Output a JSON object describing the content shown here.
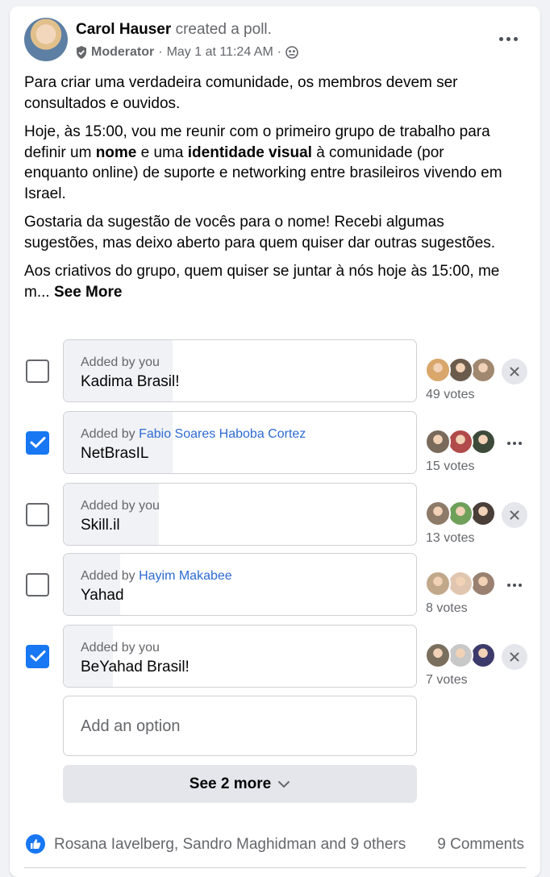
{
  "post": {
    "author": "Carol Hauser",
    "action": "created a poll.",
    "role": "Moderator",
    "timestamp": "May 1 at 11:24 AM",
    "separator": "·",
    "paragraph1": "Para criar uma verdadeira comunidade, os membros devem ser consultados e ouvidos.",
    "paragraph2_a": "Hoje, às 15:00, vou me reunir com o primeiro grupo de trabalho para definir um ",
    "paragraph2_b": "nome",
    "paragraph2_c": " e uma ",
    "paragraph2_d": "identidade visual",
    "paragraph2_e": " à comunidade (por enquanto online) de suporte e networking entre brasileiros vivendo em Israel.",
    "paragraph3": "Gostaria da sugestão de vocês para o nome! Recebi algumas sugestões, mas deixo aberto para quem quiser dar outras sugestões.",
    "paragraph4": "Aos criativos do grupo, quem quiser se juntar à nós hoje às 15:00, me m... ",
    "see_more": "See More"
  },
  "poll": {
    "options": [
      {
        "added_prefix": "Added by",
        "added_by": "you",
        "label": "Kadima Brasil!",
        "votes_text": "49 votes",
        "votes": 49,
        "checked": false,
        "action": "remove",
        "fill": 0.31,
        "avatar_colors": [
          "#d9a66b",
          "#6b5b4d",
          "#a08870"
        ]
      },
      {
        "added_prefix": "Added by",
        "added_by": "Fabio Soares Haboba Cortez",
        "label": "NetBrasIL",
        "votes_text": "15 votes",
        "votes": 15,
        "checked": true,
        "action": "more",
        "fill": 0.31,
        "avatar_colors": [
          "#7a6a5c",
          "#b14a4a",
          "#3d4a3a"
        ]
      },
      {
        "added_prefix": "Added by",
        "added_by": "you",
        "label": "Skill.il",
        "votes_text": "13 votes",
        "votes": 13,
        "checked": false,
        "action": "remove",
        "fill": 0.27,
        "avatar_colors": [
          "#8d7a68",
          "#6fa05a",
          "#4a3e38"
        ]
      },
      {
        "added_prefix": "Added by",
        "added_by": "Hayim Makabee",
        "label": "Yahad",
        "votes_text": "8 votes",
        "votes": 8,
        "checked": false,
        "action": "more",
        "fill": 0.16,
        "avatar_colors": [
          "#c2a88a",
          "#e0c6b0",
          "#9a8070"
        ]
      },
      {
        "added_prefix": "Added by",
        "added_by": "you",
        "label": "BeYahad Brasil!",
        "votes_text": "7 votes",
        "votes": 7,
        "checked": true,
        "action": "remove",
        "fill": 0.14,
        "avatar_colors": [
          "#7a6e5e",
          "#c8c8c8",
          "#3c3a6a"
        ]
      }
    ],
    "add_option_placeholder": "Add an option",
    "see_more_options": "See 2 more"
  },
  "footer": {
    "reactors": "Rosana Iavelberg, Sandro Maghidman and 9 others",
    "comments": "9 Comments"
  },
  "colors": {
    "accent": "#1877f2",
    "link": "#2d6bd3",
    "secondary_text": "#65676b",
    "fill": "#f0f2f5"
  }
}
